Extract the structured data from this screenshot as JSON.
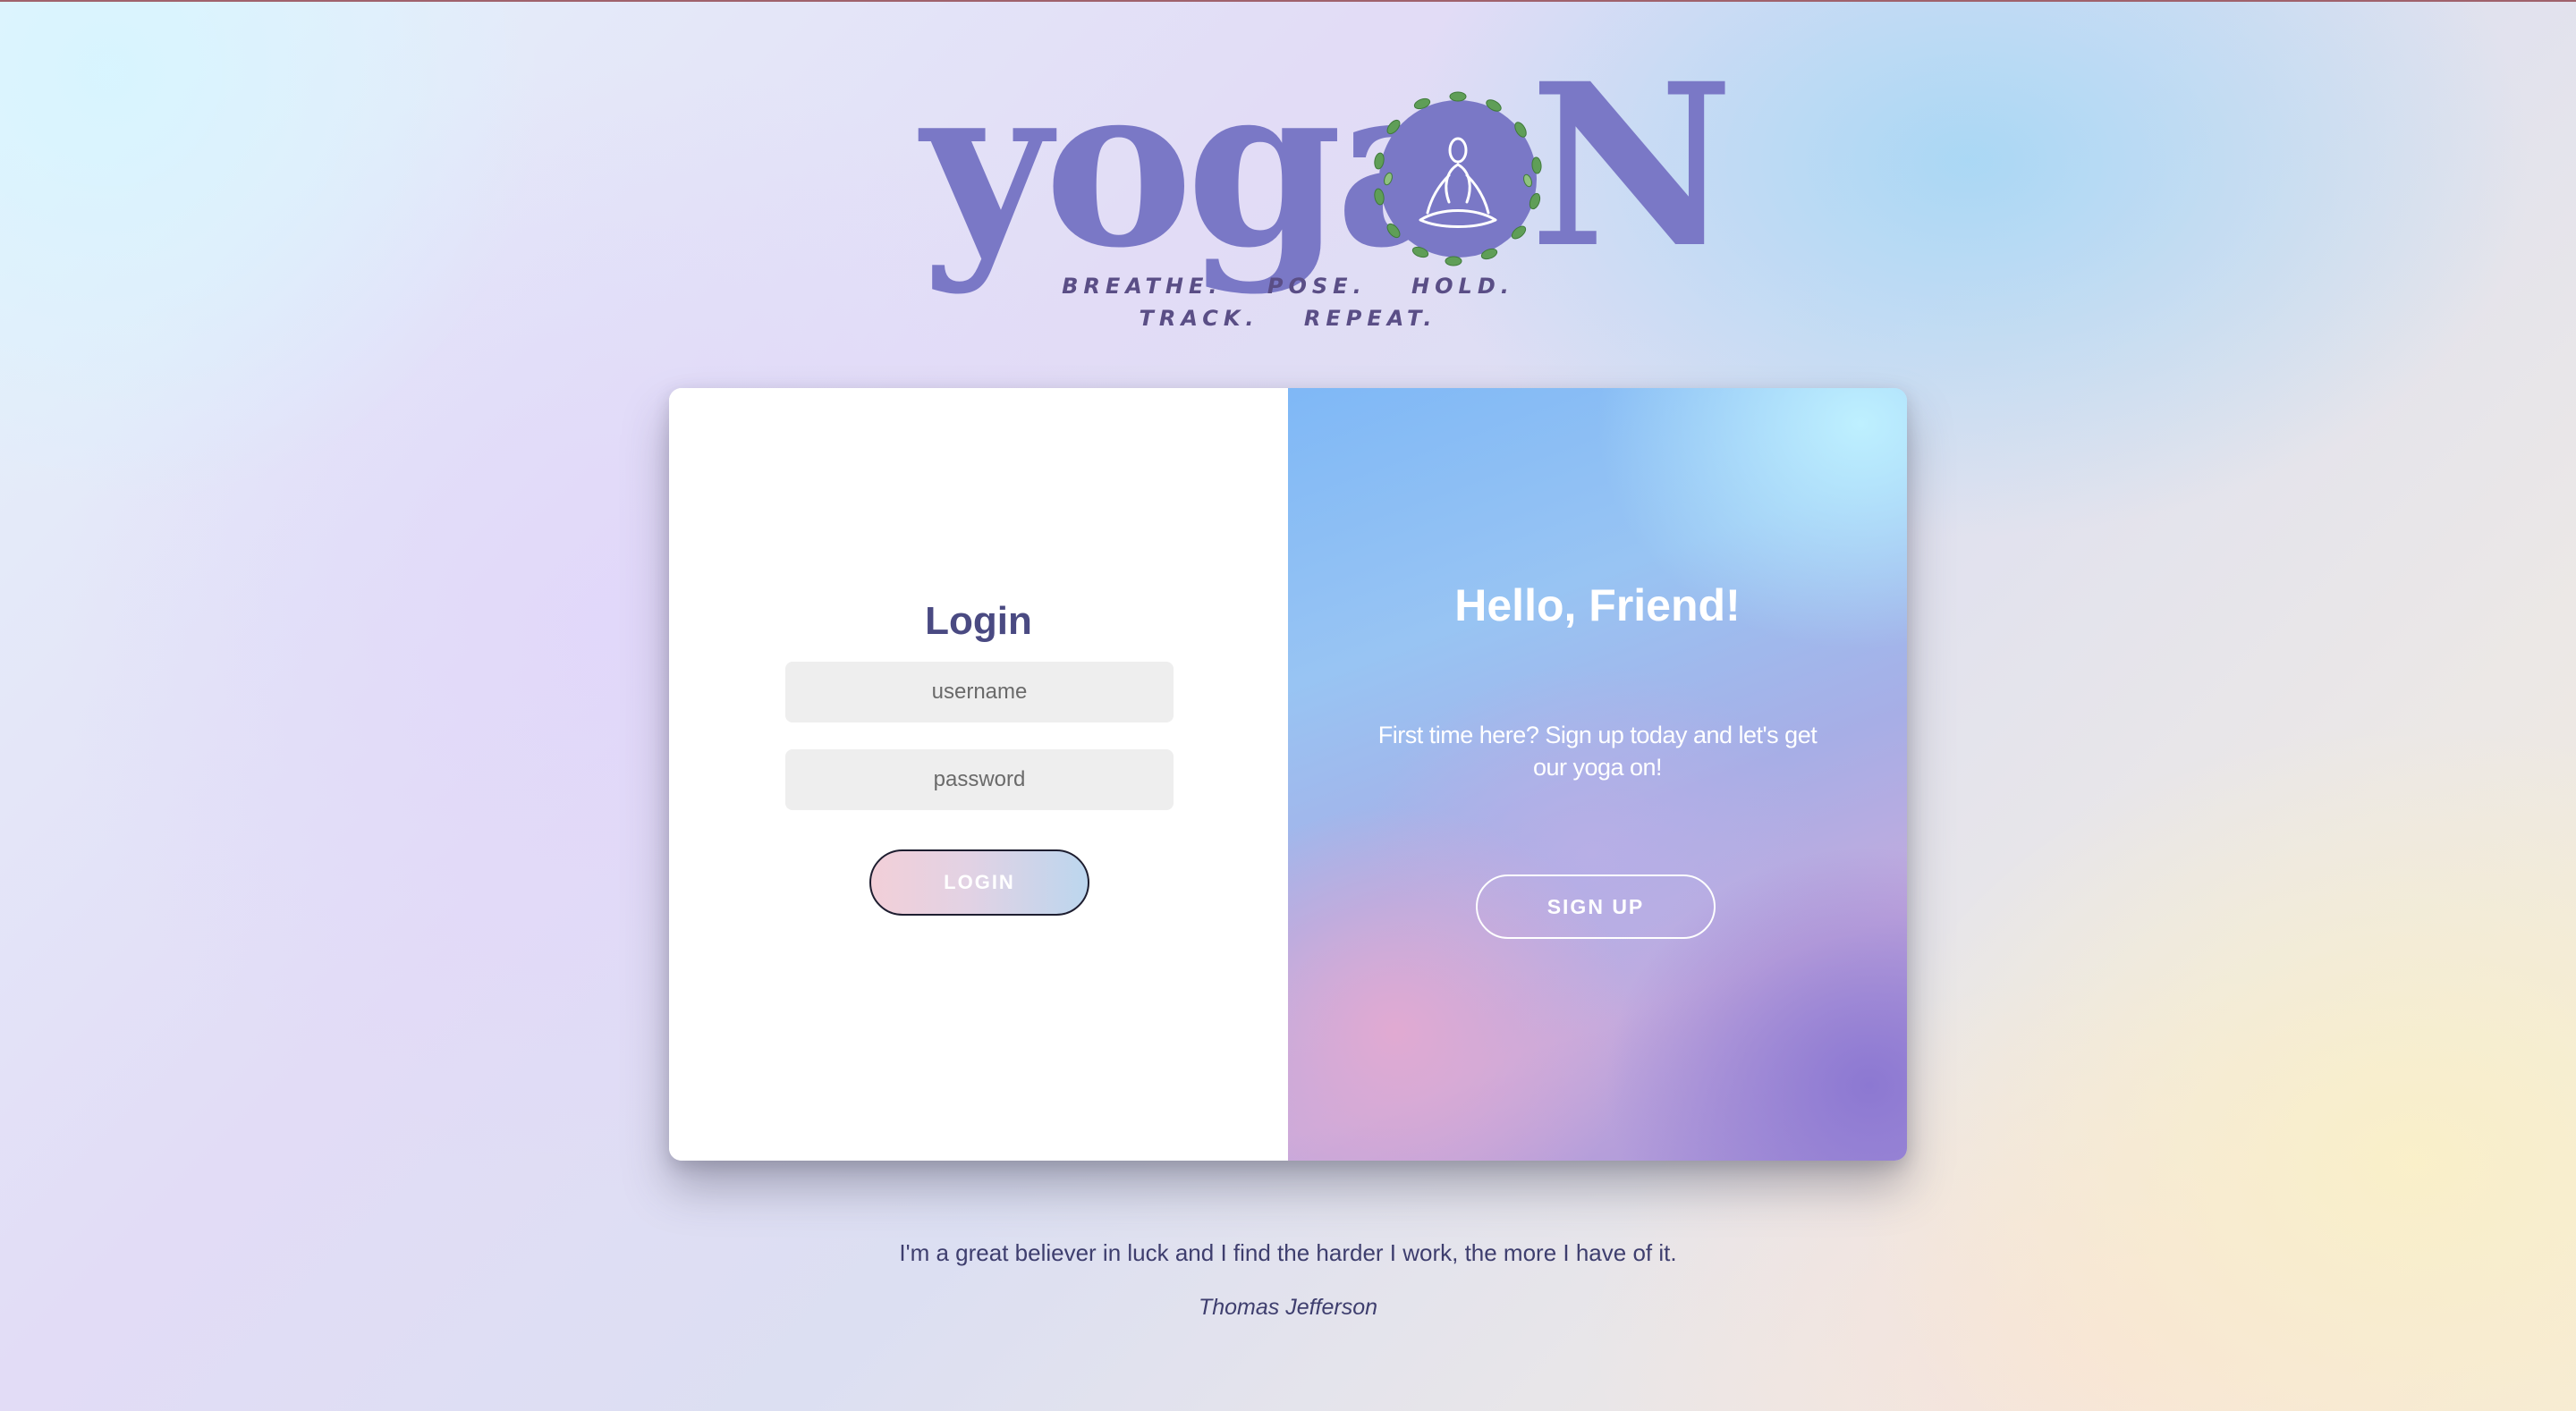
{
  "logo": {
    "word": "yoga",
    "letter_n": "N",
    "tagline_line1": [
      "BREATHE.",
      "POSE.",
      "HOLD."
    ],
    "tagline_line2": [
      "TRACK.",
      "REPEAT."
    ],
    "emblem_icon": "meditation-wreath-icon"
  },
  "login": {
    "title": "Login",
    "username_placeholder": "username",
    "password_placeholder": "password",
    "button_label": "LOGIN"
  },
  "signup": {
    "title": "Hello, Friend!",
    "text": "First time here? Sign up today and let's get our yoga on!",
    "button_label": "SIGN UP"
  },
  "quote": {
    "text": "I'm a great believer in luck and I find the harder I work, the more I have of it.",
    "author": "Thomas Jefferson"
  },
  "colors": {
    "brand_purple": "#7a78c6",
    "title_navy": "#4a4a82",
    "text_navy": "#3e3e6e",
    "field_bg": "#eeeeee"
  }
}
